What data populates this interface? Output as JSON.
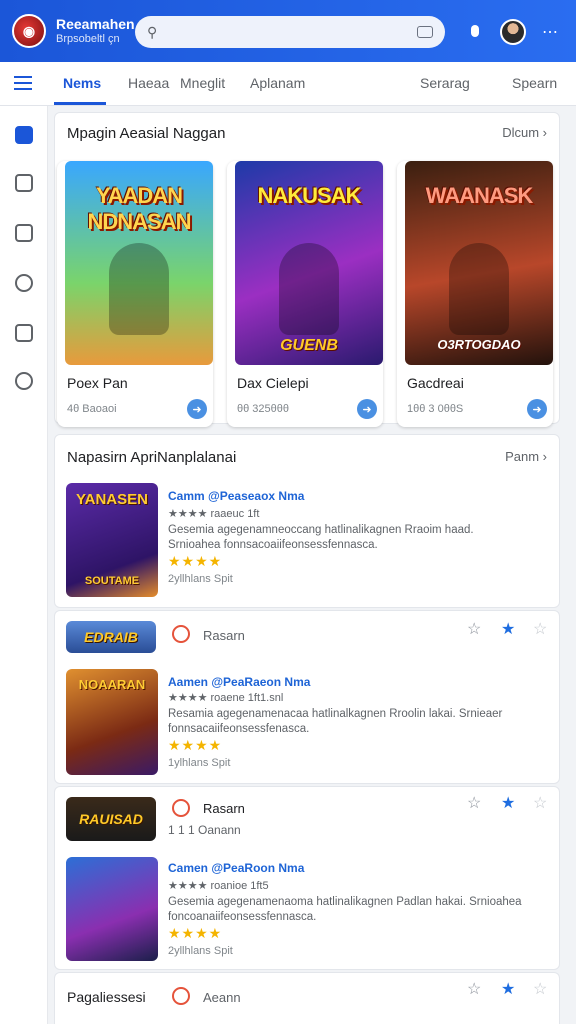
{
  "header": {
    "app_name": "Reeamahen",
    "app_subtitle": "Brpsobeltl çn",
    "search_placeholder": ""
  },
  "tabs": [
    {
      "label": "Nems",
      "active": true
    },
    {
      "label": "Haeaa"
    },
    {
      "label": "Mneglit"
    },
    {
      "label": "Aplanam"
    },
    {
      "label": "Serarag"
    },
    {
      "label": "Spearn"
    }
  ],
  "featured": {
    "title": "Mpagin Aeasial Naggan",
    "link": "Dlcum",
    "items": [
      {
        "art_title": "YAADAN NDNASAN",
        "art_sub": "",
        "name": "Poex Pan",
        "meta": "4θ Baoaoi"
      },
      {
        "art_title": "NAKUSAK",
        "art_sub": "GUENB",
        "name": "Dax Cielepi",
        "meta": "θθ 325θθθ"
      },
      {
        "art_title": "WAANASK",
        "art_sub": "O3RTOGDAO",
        "name": "Gacdreai",
        "meta": "1θθ 3 0θθS"
      }
    ]
  },
  "list_section": {
    "title": "Napasirn ApriNanplalanai",
    "link": "Panm"
  },
  "list_rows": [
    {
      "thumb_label": "SOUTAME",
      "title": "Camm @Peaseaox  Nma",
      "sub": "★★★★ raaeuc 1ft",
      "desc": "Gesemia agegenamneoccang  hatlinalikagnen Rraoim haad. Srnioahea fonnsacoaiifeonsessfennasca.",
      "meta": "2yllhlans  Spit"
    },
    {
      "badge": "EDRAIB",
      "mini_text": "Rasarn",
      "thumb_label": "NOAARAN",
      "title": "Aamen @PeaRaeon  Nma",
      "sub": "★★★★ roaene 1ft1.snl",
      "desc": "Resamia agegenamenacaa  hatlinalkagnen Rroolin lakai. Srnieaer fonnsacaiifeonsessfenasca.",
      "meta": "1ylhlans  Spit"
    },
    {
      "badge": "RAUISAD",
      "mini_text": "Rasarn",
      "mini_text2": "1 1 1  Oanann",
      "thumb_label": "",
      "title": "Camen @PeaRoon  Nma",
      "sub": "★★★★ roanioe 1ft5",
      "desc": "Gesemia agegenamenaoma  hatlinalikagnen Padlan hakai. Srnioahea foncoanaiifeonsessfennasca.",
      "meta": "2yllhlans  Spit"
    }
  ],
  "footer_row": {
    "title": "Pagaliessesi",
    "mini_text": "Aeann"
  },
  "colors": {
    "accent": "#1b56d8",
    "star": "#f4b400"
  }
}
